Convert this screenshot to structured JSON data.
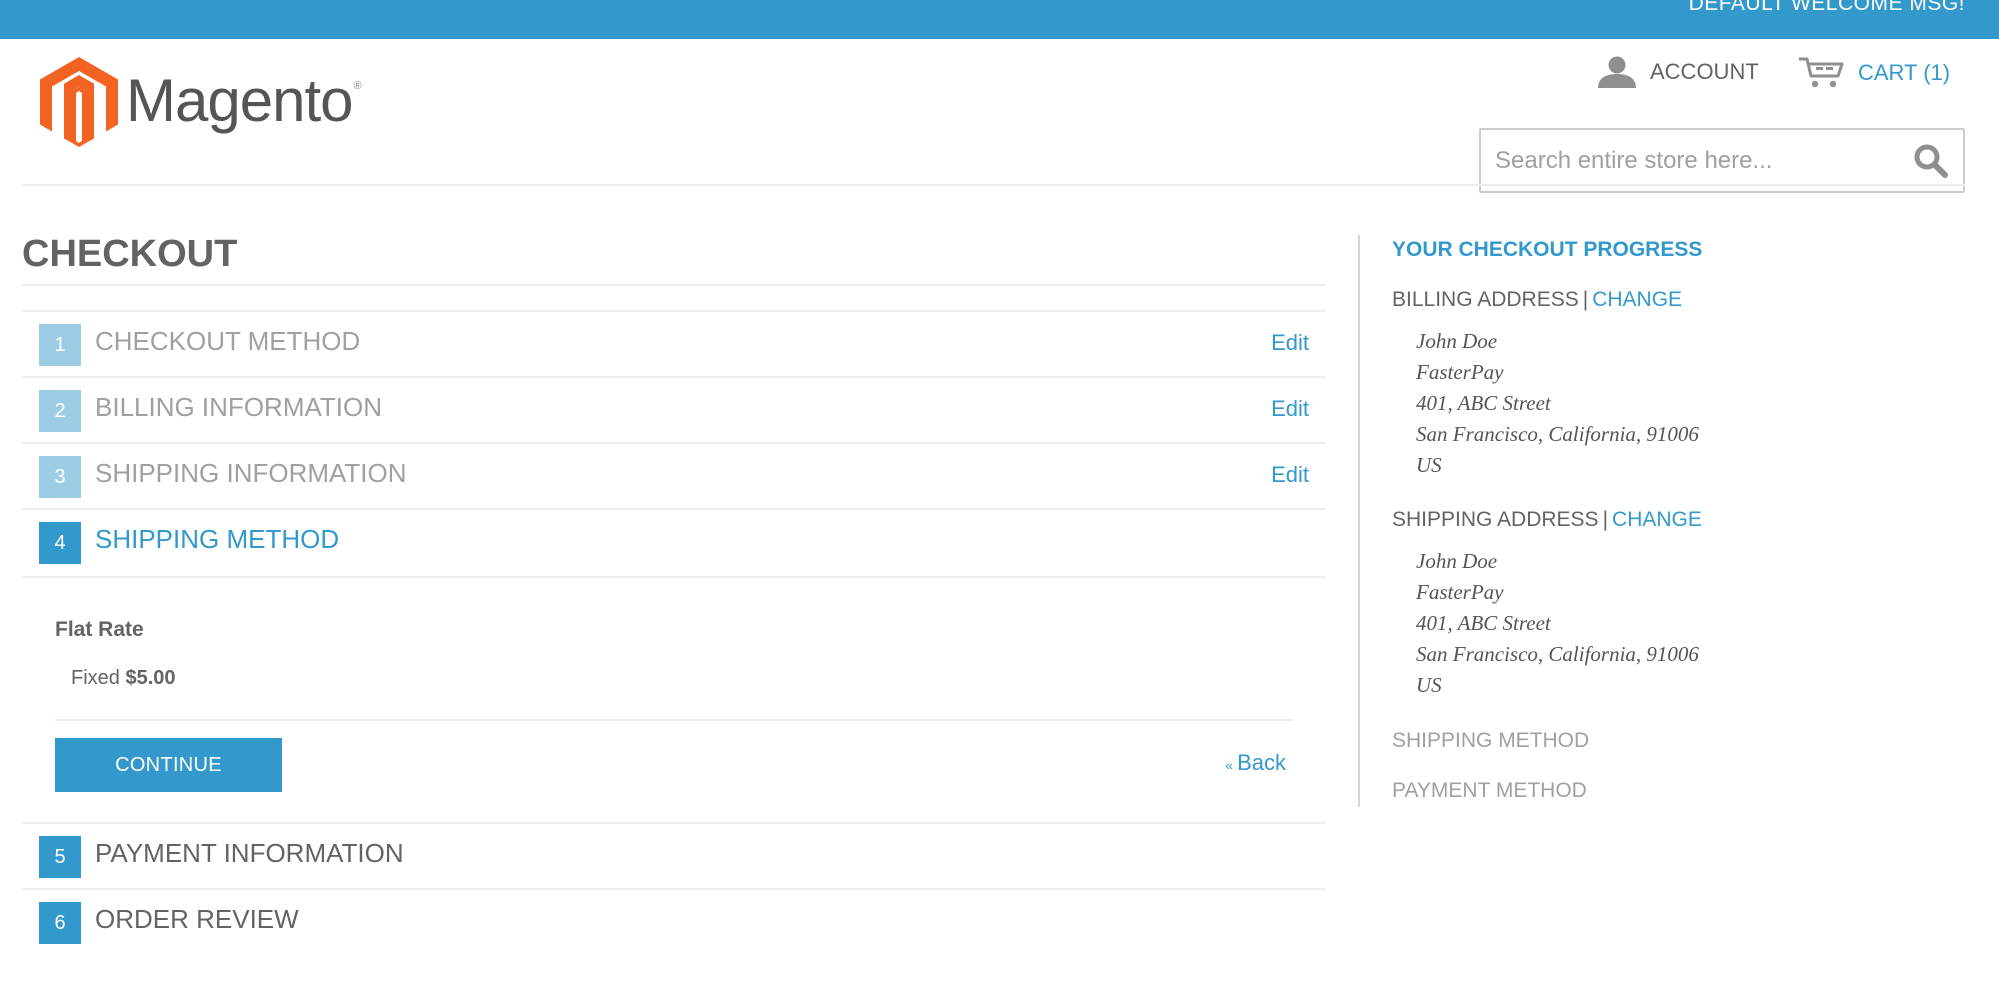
{
  "topbar": {
    "welcome_message": "DEFAULT WELCOME MSG!"
  },
  "header": {
    "logo_text": "Magento",
    "logo_registered": "®",
    "account_label": "ACCOUNT",
    "account_icon": "user-icon",
    "cart_label": "CART (1)",
    "cart_icon": "cart-icon",
    "cart_count": 1,
    "search": {
      "placeholder": "Search entire store here...",
      "value": "",
      "icon": "search-icon"
    }
  },
  "colors": {
    "brand": "#3399cc",
    "logo_orange": "#f26322",
    "step_done": "#9dcde5",
    "text": "#636363"
  },
  "checkout": {
    "title": "CHECKOUT",
    "steps": [
      {
        "number": "1",
        "title": "CHECKOUT METHOD",
        "state": "done",
        "edit_label": "Edit"
      },
      {
        "number": "2",
        "title": "BILLING INFORMATION",
        "state": "done",
        "edit_label": "Edit"
      },
      {
        "number": "3",
        "title": "SHIPPING INFORMATION",
        "state": "done",
        "edit_label": "Edit"
      },
      {
        "number": "4",
        "title": "SHIPPING METHOD",
        "state": "active",
        "edit_label": ""
      },
      {
        "number": "5",
        "title": "PAYMENT INFORMATION",
        "state": "todo",
        "edit_label": ""
      },
      {
        "number": "6",
        "title": "ORDER REVIEW",
        "state": "todo",
        "edit_label": ""
      }
    ],
    "shipping_method": {
      "carrier": "Flat Rate",
      "rate_label": "Fixed",
      "rate_price": "$5.00",
      "continue_label": "CONTINUE",
      "back_label": "Back",
      "back_prefix": "«"
    }
  },
  "progress": {
    "title": "YOUR CHECKOUT PROGRESS",
    "billing": {
      "label": "BILLING ADDRESS",
      "separator": "|",
      "change_label": "CHANGE",
      "lines": [
        "John Doe",
        "FasterPay",
        "401, ABC Street",
        "San Francisco, California, 91006",
        "US"
      ]
    },
    "shipping": {
      "label": "SHIPPING ADDRESS",
      "separator": "|",
      "change_label": "CHANGE",
      "lines": [
        "John Doe",
        "FasterPay",
        "401, ABC Street",
        "San Francisco, California, 91006",
        "US"
      ]
    },
    "shipping_method_label": "SHIPPING METHOD",
    "payment_method_label": "PAYMENT METHOD"
  }
}
